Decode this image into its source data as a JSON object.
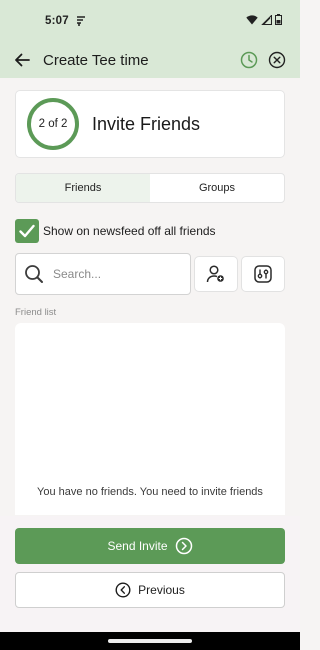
{
  "status_bar": {
    "time": "5:07"
  },
  "header": {
    "title": "Create Tee time",
    "back_icon": "arrow-left-icon",
    "clock_icon": "clock-icon",
    "close_icon": "close-circle-icon",
    "accent_color": "#5c9a57"
  },
  "step": {
    "indicator": "2 of 2",
    "title": "Invite Friends"
  },
  "tabs": [
    {
      "label": "Friends",
      "active": true
    },
    {
      "label": "Groups",
      "active": false
    }
  ],
  "newsfeed_option": {
    "label": "Show on newsfeed off all friends",
    "checked": true
  },
  "search": {
    "placeholder": "Search...",
    "value": ""
  },
  "friend_list": {
    "label": "Friend list",
    "empty_message": "You have no friends. You need to invite friends"
  },
  "buttons": {
    "send_invite": "Send Invite",
    "previous": "Previous"
  },
  "colors": {
    "primary": "#5c9a57",
    "header_bg": "#d9e8d6",
    "tab_active_bg": "#edf3ec"
  }
}
